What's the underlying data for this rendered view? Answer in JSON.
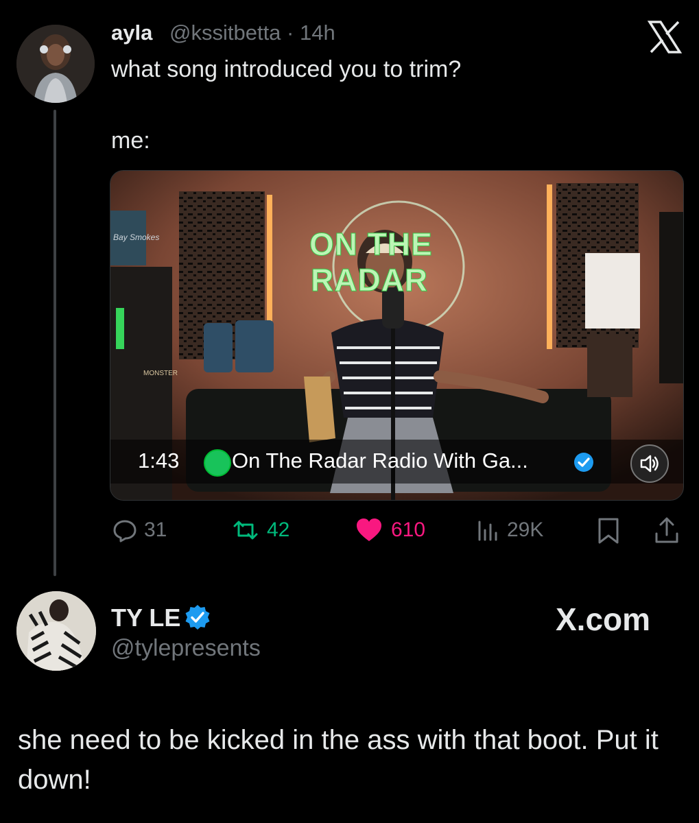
{
  "tweet": {
    "author_name": "ayla",
    "author_handle": "@kssitbetta · 14h",
    "text_line1": "what song introduced you to trim?",
    "text_line2": "me:",
    "media": {
      "sign_line1": "ON THE",
      "sign_line2": "RADAR",
      "duration": "1:43",
      "title": "On The Radar Radio With Ga...",
      "corner_logo": "ON THE RADAR",
      "bag_text": "Bay Smokes",
      "fridge_text": "MONSTER"
    },
    "stats": {
      "replies": "31",
      "retweets": "42",
      "likes": "610",
      "views": "29K"
    },
    "icons": [
      "x-logo",
      "reply-icon",
      "retweet-icon",
      "heart-icon",
      "views-icon",
      "bookmark-icon",
      "share-icon",
      "verified-icon",
      "speaker-icon"
    ]
  },
  "reply": {
    "author_name": "TY LE",
    "author_handle": "@tylepresents",
    "site": "X.com",
    "text": "she need to be kicked in the ass with that boot. Put it down!"
  },
  "colors": {
    "background": "#000000",
    "text": "#e7e9ea",
    "muted": "#71767b",
    "retweet": "#00ba7c",
    "like": "#f91880",
    "verified": "#1d9bf0"
  }
}
